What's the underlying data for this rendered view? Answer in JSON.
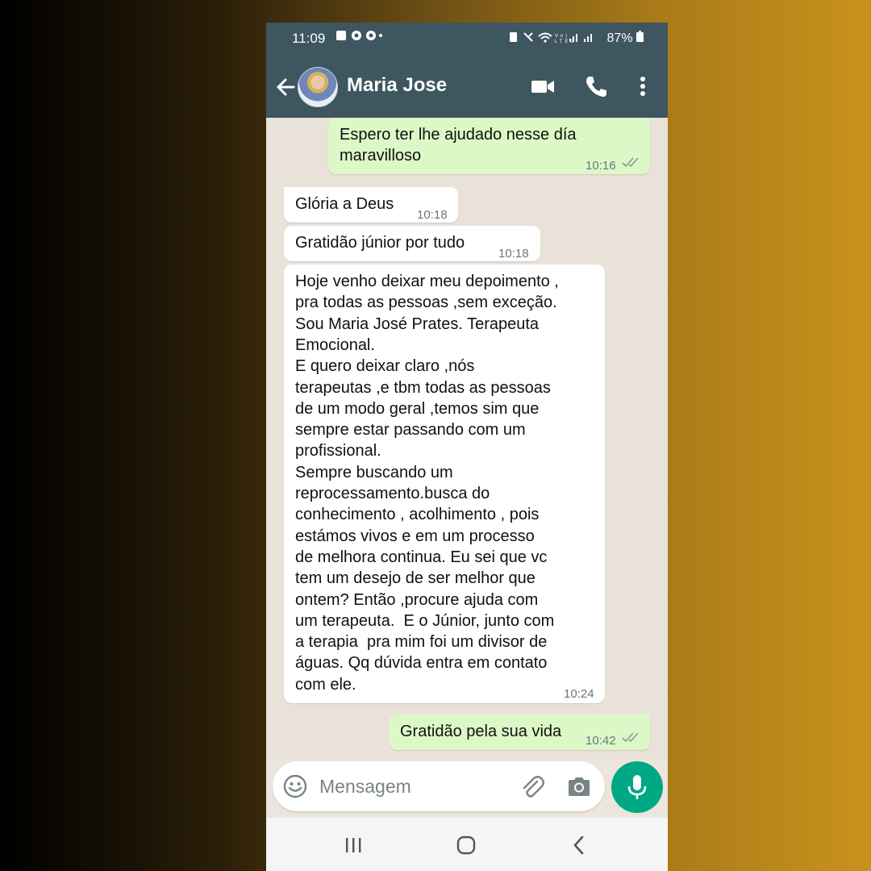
{
  "status_bar": {
    "time": "11:09",
    "battery": "87%"
  },
  "header": {
    "contact_name": "Maria Jose"
  },
  "messages": [
    {
      "direction": "outgoing",
      "lines": [
        "Espero ter lhe ajudado nesse día",
        "maravilloso"
      ],
      "time": "10:16",
      "read": true
    },
    {
      "direction": "incoming",
      "lines": [
        "Glória a Deus"
      ],
      "time": "10:18"
    },
    {
      "direction": "incoming",
      "lines": [
        "Gratidão júnior por tudo"
      ],
      "time": "10:18"
    },
    {
      "direction": "incoming",
      "lines": [
        "Hoje venho deixar meu depoimento ,",
        "pra todas as pessoas ,sem exceção.",
        "Sou Maria José Prates. Terapeuta",
        "Emocional.",
        "E quero deixar claro ,nós",
        "terapeutas ,e tbm todas as pessoas",
        "de um modo geral ,temos sim que",
        "sempre estar passando com um",
        "profissional.",
        "Sempre buscando um",
        "reprocessamento.busca do",
        "conhecimento , acolhimento , pois",
        "estámos vivos e em um processo",
        "de melhora continua. Eu sei que vc",
        "tem um desejo de ser melhor que",
        "ontem? Então ,procure ajuda com",
        "um terapeuta.  E o Júnior, junto com",
        "a terapia  pra mim foi um divisor de",
        "águas. Qq dúvida entra em contato",
        "com ele."
      ],
      "time": "10:24"
    },
    {
      "direction": "outgoing",
      "lines": [
        "Gratidão pela sua vida"
      ],
      "time": "10:42",
      "read": true
    }
  ],
  "input": {
    "placeholder": "Mensagem"
  },
  "icons": {
    "back": "arrow-left-icon",
    "video": "video-camera-icon",
    "call": "phone-icon",
    "menu": "more-vertical-icon",
    "emoji": "emoji-icon",
    "attach": "paperclip-icon",
    "camera": "camera-icon",
    "mic": "microphone-icon"
  },
  "colors": {
    "header": "#3d5660",
    "outgoing_bubble": "#dcf8c6",
    "incoming_bubble": "#ffffff",
    "chat_background": "#e9e2d9",
    "accent": "#00a884",
    "read_ticks": "#8a9a9f"
  }
}
